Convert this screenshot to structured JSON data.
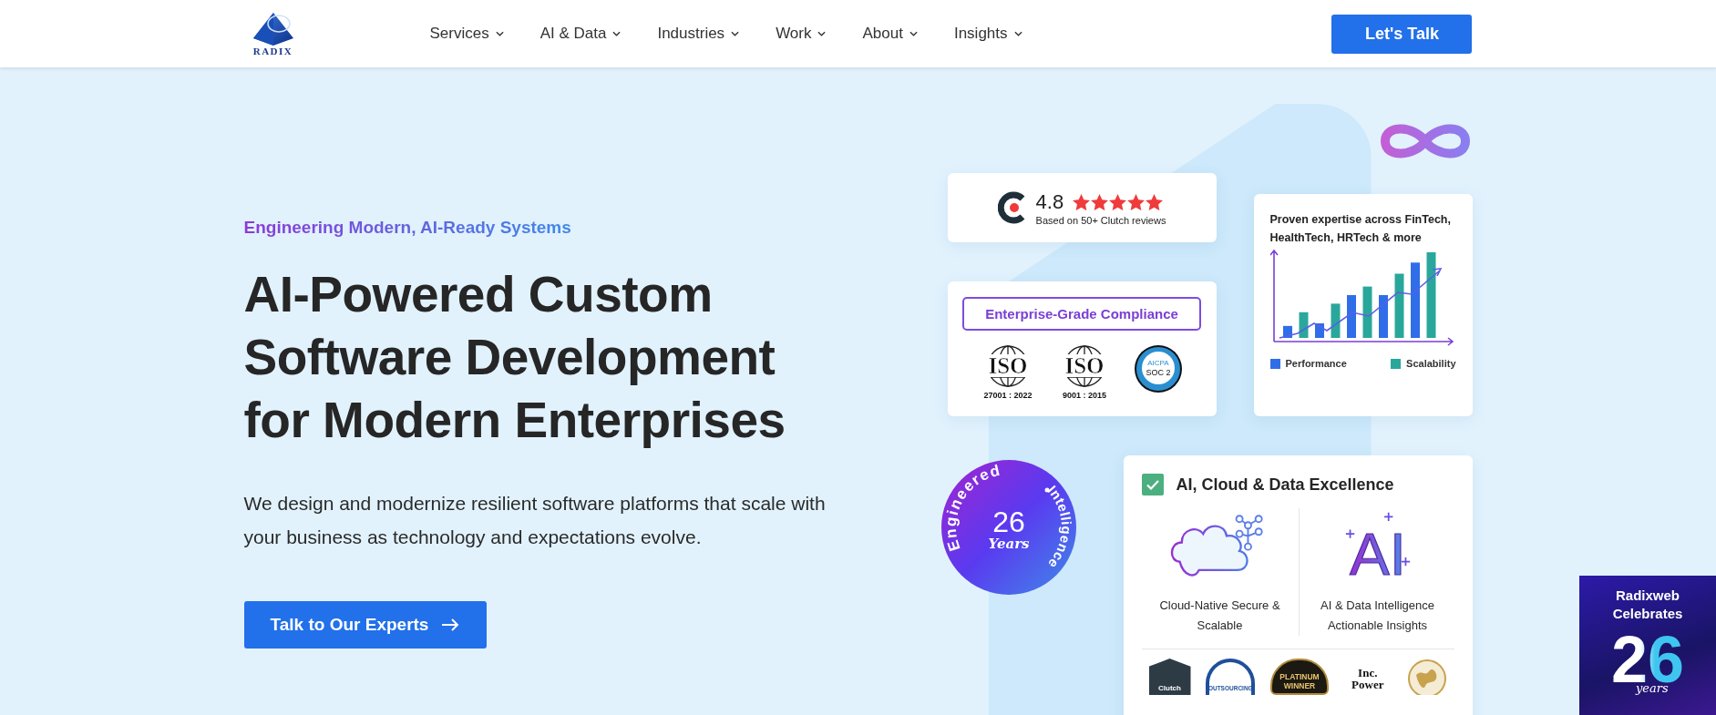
{
  "header": {
    "logo_text": "RADIX",
    "nav": [
      {
        "label": "Services"
      },
      {
        "label": "AI & Data"
      },
      {
        "label": "Industries"
      },
      {
        "label": "Work"
      },
      {
        "label": "About"
      },
      {
        "label": "Insights"
      }
    ],
    "cta": "Let's Talk"
  },
  "hero": {
    "tagline": "Engineering Modern, AI-Ready Systems",
    "title_lines": [
      "AI-Powered Custom",
      "Software Development",
      "for Modern Enterprises"
    ],
    "description": "We design and modernize resilient software platforms that scale with your business as technology and expectations evolve.",
    "cta": "Talk to Our Experts"
  },
  "rating_card": {
    "score": "4.8",
    "stars": 5,
    "caption": "Based on 50+ Clutch reviews"
  },
  "compliance_card": {
    "title": "Enterprise-Grade Compliance",
    "certs": [
      {
        "kind": "iso",
        "mark": "ISO",
        "caption": "27001 : 2022"
      },
      {
        "kind": "iso",
        "mark": "ISO",
        "caption": "9001 : 2015"
      },
      {
        "kind": "soc",
        "mark": "AICPA",
        "caption": "SOC 2"
      }
    ]
  },
  "chart_card": {
    "title": "Proven expertise across FinTech, HealthTech, HRTech & more",
    "legend": [
      {
        "label": "Performance",
        "color": "#2f6ee8"
      },
      {
        "label": "Scalability",
        "color": "#2aa79b"
      }
    ]
  },
  "anniversary_badge": {
    "top_text": "Engineered",
    "side_text": "Intelligence",
    "number": "26",
    "unit": "Years"
  },
  "excellence_card": {
    "title": "AI, Cloud & Data Excellence",
    "checked": true,
    "features": [
      {
        "kind": "cloud",
        "label": "Cloud-Native Secure & Scalable"
      },
      {
        "kind": "ai",
        "icon_text": "AI",
        "label": "AI & Data Intelligence Actionable Insights"
      }
    ],
    "awards": [
      {
        "kind": "shield",
        "label": "Clutch"
      },
      {
        "kind": "arc",
        "label": "OUTSOURCING"
      },
      {
        "kind": "oval",
        "label": "PLATINUM WINNER"
      },
      {
        "kind": "wordmark",
        "label": "Inc. Power"
      },
      {
        "kind": "globe"
      }
    ]
  },
  "promo": {
    "title": "Radixweb Celebrates",
    "number": "26",
    "unit": "years"
  }
}
